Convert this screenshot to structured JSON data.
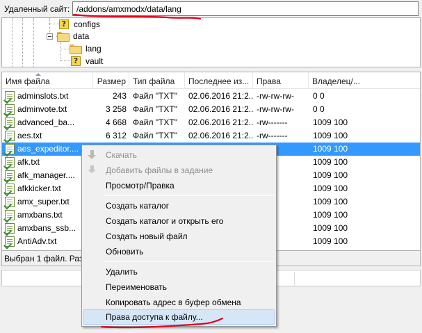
{
  "path_bar": {
    "label": "Удаленный сайт:",
    "value": "/addons/amxmodx/data/lang"
  },
  "tree": {
    "nodes": [
      {
        "label": "configs",
        "icon": "unknown-folder-icon"
      },
      {
        "label": "data",
        "icon": "folder-open-icon"
      },
      {
        "label": "lang",
        "icon": "folder-open-icon"
      },
      {
        "label": "vault",
        "icon": "unknown-folder-icon"
      }
    ]
  },
  "list": {
    "columns": [
      "Имя файла",
      "Размер",
      "Тип файла",
      "Последнее из...",
      "Права",
      "Владелец/..."
    ],
    "rows": [
      {
        "name": "adminslots.txt",
        "size": "243",
        "type": "Файл \"TXT\"",
        "modified": "02.06.2016 21:2...",
        "perms": "-rw-rw-rw-",
        "owner": "0 0"
      },
      {
        "name": "adminvote.txt",
        "size": "3 258",
        "type": "Файл \"TXT\"",
        "modified": "02.06.2016 21:2...",
        "perms": "-rw-rw-rw-",
        "owner": "0 0"
      },
      {
        "name": "advanced_ba...",
        "size": "4 668",
        "type": "Файл \"TXT\"",
        "modified": "02.06.2016 21:2...",
        "perms": "-rw-------",
        "owner": "1009 100"
      },
      {
        "name": "aes.txt",
        "size": "6 312",
        "type": "Файл \"TXT\"",
        "modified": "02.06.2016 21:2...",
        "perms": "-rw-------",
        "owner": "1009 100"
      },
      {
        "name": "aes_expeditor....",
        "size": "",
        "type": "",
        "modified": "",
        "perms": "-------",
        "owner": "1009 100"
      },
      {
        "name": "afk.txt",
        "size": "",
        "type": "",
        "modified": "",
        "perms": "-------",
        "owner": "1009 100"
      },
      {
        "name": "afk_manager....",
        "size": "",
        "type": "",
        "modified": "",
        "perms": "-------",
        "owner": "1009 100"
      },
      {
        "name": "afkkicker.txt",
        "size": "",
        "type": "",
        "modified": "",
        "perms": "-------",
        "owner": "1009 100"
      },
      {
        "name": "amx_super.txt",
        "size": "",
        "type": "",
        "modified": "",
        "perms": "-------",
        "owner": "1009 100"
      },
      {
        "name": "amxbans.txt",
        "size": "",
        "type": "",
        "modified": "",
        "perms": "-------",
        "owner": "1009 100"
      },
      {
        "name": "amxbans_ssb...",
        "size": "",
        "type": "",
        "modified": "",
        "perms": "-------",
        "owner": "1009 100"
      },
      {
        "name": "AntiAdv.txt",
        "size": "",
        "type": "",
        "modified": "",
        "perms": "-------",
        "owner": "1009 100"
      }
    ],
    "selected_index": 4
  },
  "status": {
    "text": "Выбран 1 файл. Разм"
  },
  "context_menu": {
    "download": "Скачать",
    "add_to_queue": "Добавить файлы в задание",
    "view_edit": "Просмотр/Правка",
    "create_dir": "Создать каталог",
    "create_dir_open": "Создать каталог и открыть его",
    "create_file": "Создать новый файл",
    "refresh": "Обновить",
    "delete": "Удалить",
    "rename": "Переименовать",
    "copy_url": "Копировать адрес в буфер обмена",
    "file_permissions": "Права доступа к файлу..."
  },
  "colors": {
    "selection": "#3399ff",
    "menu_highlight": "#d5e6f7",
    "annotation": "#e0001a"
  }
}
